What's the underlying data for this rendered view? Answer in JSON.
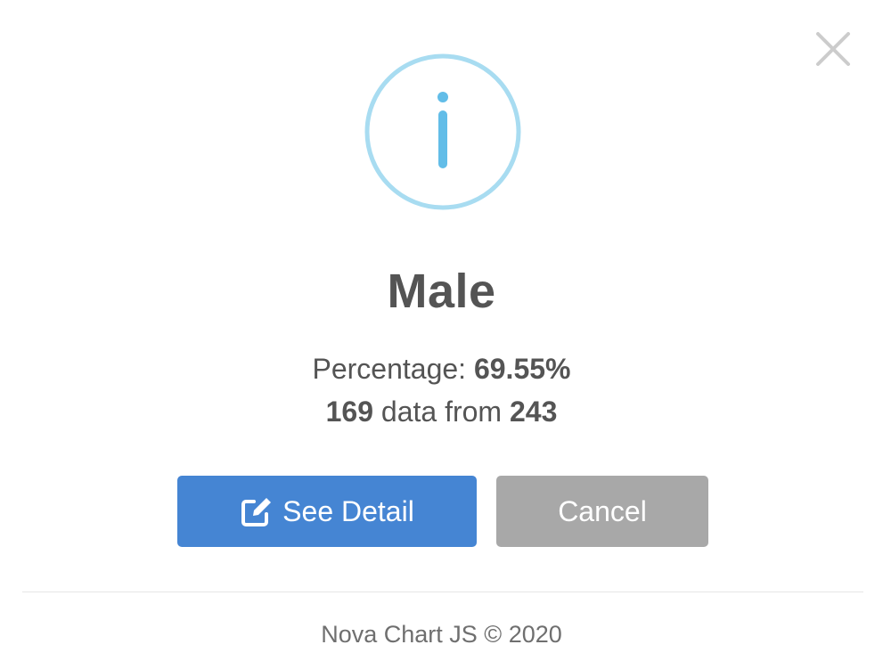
{
  "dialog": {
    "title": "Male",
    "percentage_label": "Percentage:",
    "percentage_value": "69.55%",
    "count_value": "169",
    "count_middle": "data from",
    "total_value": "243",
    "confirm_label": "See Detail",
    "cancel_label": "Cancel",
    "footer": "Nova Chart JS © 2020",
    "icons": {
      "status": "info-circle-icon",
      "close": "close-x-icon",
      "confirm": "external-link-icon"
    },
    "colors": {
      "info_ring": "#a8dcf1",
      "info_glyph": "#62bde8",
      "confirm_button": "#4585d3",
      "cancel_button": "#a8a8a8",
      "text": "#545454"
    }
  }
}
